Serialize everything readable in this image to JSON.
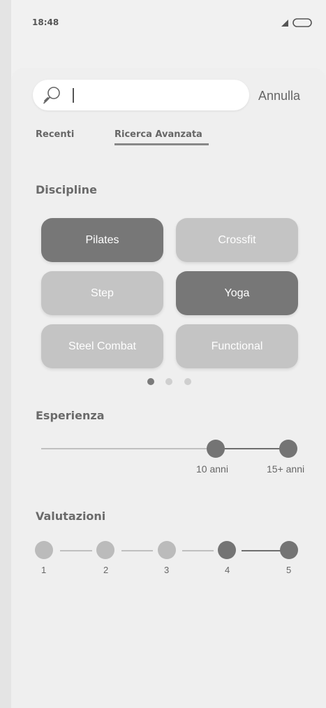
{
  "status": {
    "time": "18:48"
  },
  "search": {
    "value": "",
    "cancel_label": "Annulla"
  },
  "tabs": [
    {
      "label": "Recenti",
      "active": false
    },
    {
      "label": "Ricerca Avanzata",
      "active": true
    }
  ],
  "disciplines": {
    "title": "Discipline",
    "items": [
      {
        "label": "Pilates",
        "selected": true
      },
      {
        "label": "Crossfit",
        "selected": false
      },
      {
        "label": "Step",
        "selected": false
      },
      {
        "label": "Yoga",
        "selected": true
      },
      {
        "label": "Steel Combat",
        "selected": false
      },
      {
        "label": "Functional",
        "selected": false
      }
    ],
    "pages": 3,
    "current_page": 1
  },
  "experience": {
    "title": "Esperienza",
    "labels": [
      "10 anni",
      "15+ anni"
    ]
  },
  "ratings": {
    "title": "Valutazioni",
    "values": [
      "1",
      "2",
      "3",
      "4",
      "5"
    ],
    "selected_from": 4,
    "selected_to": 5
  },
  "colors": {
    "active": "#777777",
    "inactive": "#c4c4c4",
    "background": "#efefef"
  }
}
